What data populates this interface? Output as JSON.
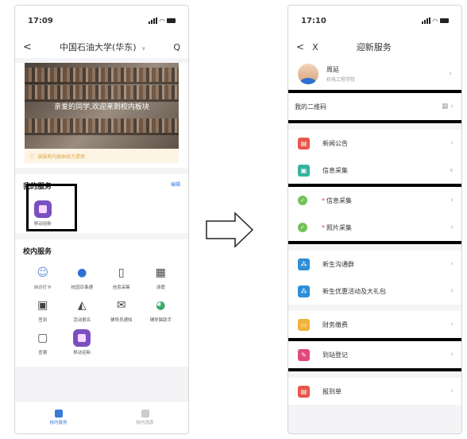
{
  "left": {
    "status": {
      "time": "17:09"
    },
    "nav": {
      "back": "<",
      "title": "中国石油大学(华东)",
      "chevron": "∨",
      "search": "Q"
    },
    "banner": {
      "text": "亲爱的同学,欢迎来到校内板块"
    },
    "notice": "该服务内容由校方提供",
    "my_services": {
      "title": "我的服务",
      "edit": "编辑",
      "items": [
        {
          "label": "移动迎新",
          "icon": "welcome-app-icon"
        }
      ]
    },
    "campus_services": {
      "title": "校内服务",
      "items": [
        {
          "label": "自诊打卡",
          "icon": "person-icon"
        },
        {
          "label": "校园百事通",
          "icon": "robot-icon"
        },
        {
          "label": "信息采集",
          "icon": "clipboard-icon"
        },
        {
          "label": "请假",
          "icon": "calendar-icon"
        },
        {
          "label": "签到",
          "icon": "checkin-icon"
        },
        {
          "label": "活动报名",
          "icon": "megaphone-icon"
        },
        {
          "label": "辅导员通知",
          "icon": "notice-icon"
        },
        {
          "label": "辅导猫助手",
          "icon": "cat-icon"
        },
        {
          "label": "查寝",
          "icon": "phone-check-icon"
        },
        {
          "label": "移动迎新",
          "icon": "welcome-app-icon"
        }
      ]
    },
    "tabs": [
      {
        "label": "校内服务",
        "active": true
      },
      {
        "label": "校内消息",
        "active": false
      }
    ]
  },
  "right": {
    "status": {
      "time": "17:10"
    },
    "nav": {
      "back": "<",
      "close": "X",
      "title": "迎新服务"
    },
    "user": {
      "name": "周延",
      "college": "机电工程学院"
    },
    "qr": {
      "label": "我的二维码",
      "icon": "qr-icon"
    },
    "rows1": [
      {
        "label": "新闻公告",
        "color": "#e8574b",
        "icon": "news-icon",
        "expanded": false
      },
      {
        "label": "信息采集",
        "color": "#35b3a3",
        "icon": "collect-icon",
        "expanded": true
      }
    ],
    "subrows": [
      {
        "label": "信息采集"
      },
      {
        "label": "照片采集"
      }
    ],
    "rows2": [
      {
        "label": "新生沟通群",
        "color": "#2e8ed8",
        "icon": "group-icon"
      },
      {
        "label": "新生优惠活动及大礼包",
        "color": "#2e8ed8",
        "icon": "gift-icon"
      }
    ],
    "rows3": [
      {
        "label": "财务缴费",
        "color": "#f0b23a",
        "icon": "finance-icon"
      },
      {
        "label": "到站登记",
        "color": "#e04a7a",
        "icon": "pencil-icon"
      }
    ],
    "rows4": [
      {
        "label": "报到单",
        "color": "#e8574b",
        "icon": "form-icon"
      }
    ],
    "colors": {
      "accent": "#3b7bd8",
      "highlight": "#000000",
      "check": "#72c25a",
      "required": "#e23a3a"
    }
  }
}
